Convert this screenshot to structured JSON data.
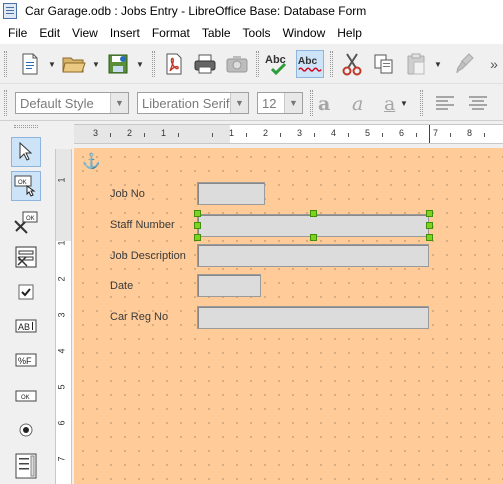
{
  "window": {
    "title": "Car Garage.odb : Jobs Entry - LibreOffice Base: Database Form"
  },
  "menu": [
    "File",
    "Edit",
    "View",
    "Insert",
    "Format",
    "Table",
    "Tools",
    "Window",
    "Help"
  ],
  "formatting": {
    "paragraph_style": "Default Style",
    "font_name": "Liberation Serif",
    "font_size": "12"
  },
  "ruler": {
    "horizontal_marks": [
      "3",
      "2",
      "1",
      "1",
      "2",
      "3",
      "4",
      "5",
      "6",
      "7",
      "8"
    ],
    "vertical_marks": [
      "1",
      "1",
      "2",
      "3",
      "4",
      "5",
      "6",
      "7"
    ]
  },
  "form": {
    "fields": [
      {
        "label": "Job No"
      },
      {
        "label": "Staff Number"
      },
      {
        "label": "Job Description"
      },
      {
        "label": "Date"
      },
      {
        "label": "Car Reg No"
      }
    ]
  },
  "colors": {
    "canvas_bg": "#ffcc99",
    "field_bg": "#dcdcdc",
    "selection_handle": "#7ed321"
  }
}
